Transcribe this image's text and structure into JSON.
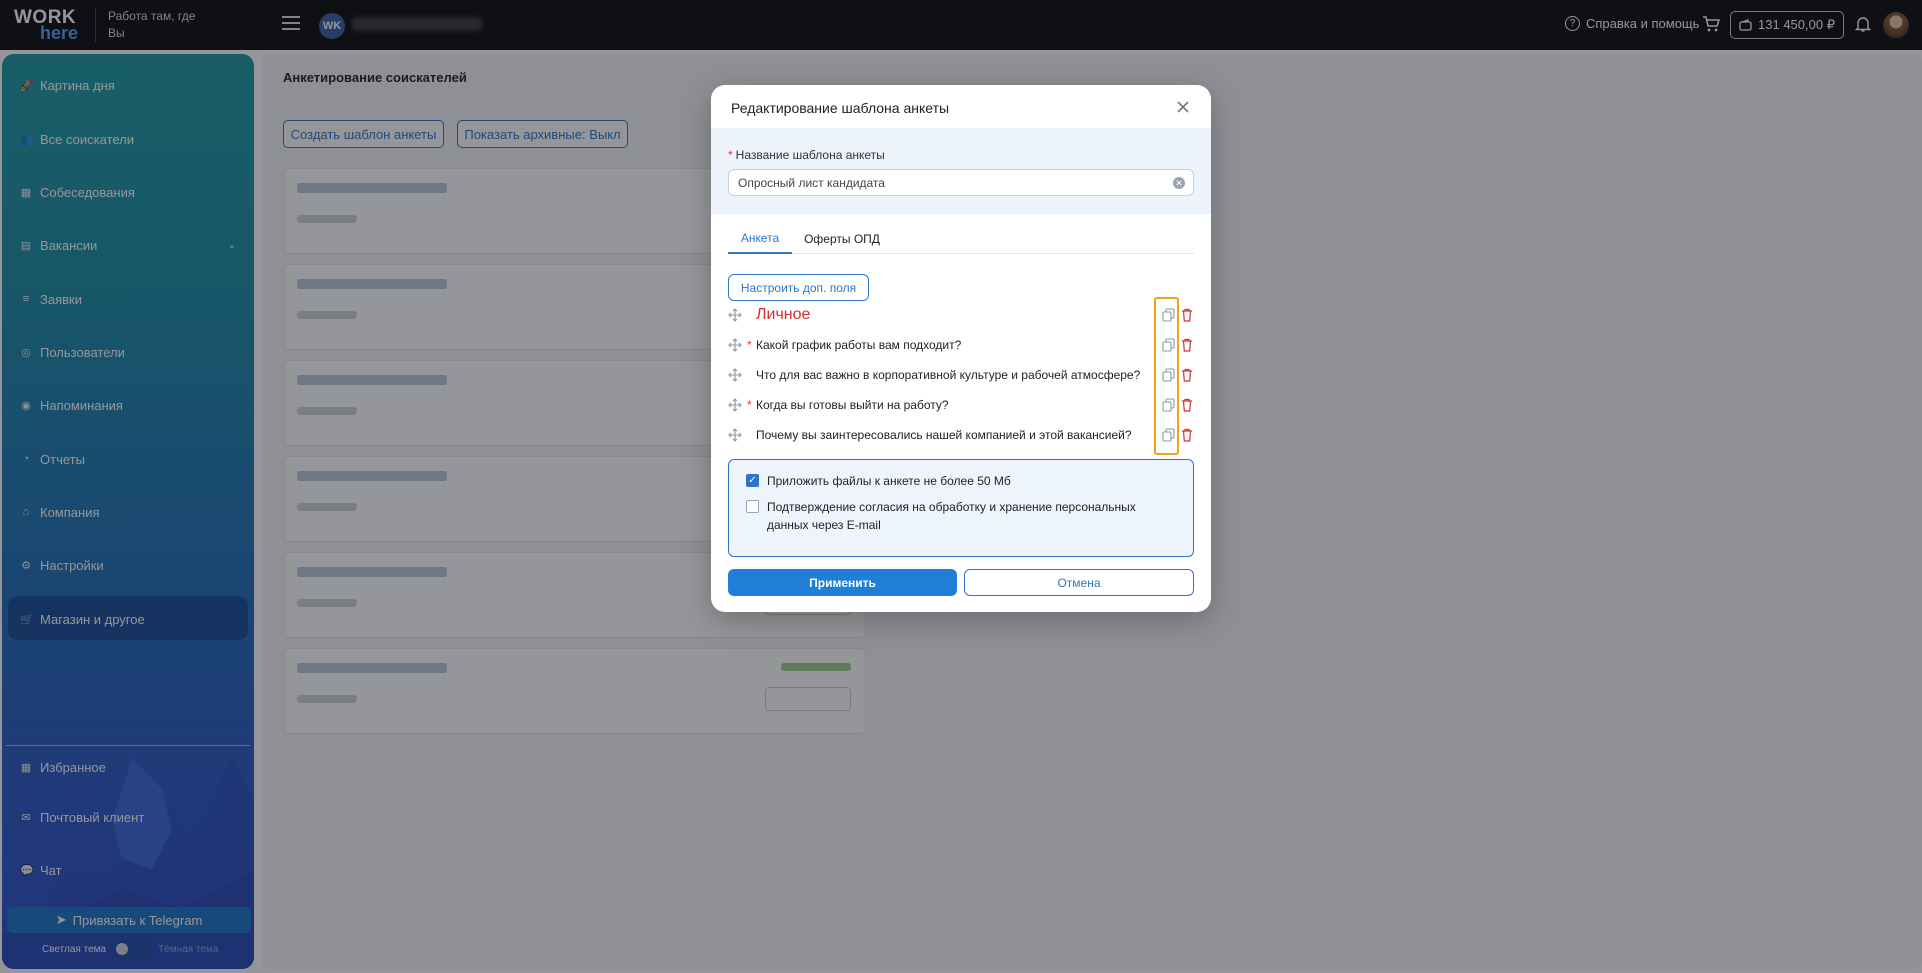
{
  "topbar": {
    "logo_top": "WORK",
    "logo_bottom": "here",
    "tagline": "Работа там, где Вы",
    "org_initials": "WK",
    "help_label": "Справка и помощь",
    "balance": "131 450,00 ₽"
  },
  "sidebar": {
    "items": [
      {
        "label": "Картина дня",
        "icon": "rocket-icon"
      },
      {
        "label": "Все соискатели",
        "icon": "users-icon"
      },
      {
        "label": "Собеседования",
        "icon": "calendar-icon"
      },
      {
        "label": "Вакансии",
        "icon": "briefcase-icon"
      },
      {
        "label": "Заявки",
        "icon": "list-icon"
      },
      {
        "label": "Пользователи",
        "icon": "user-circle-icon"
      },
      {
        "label": "Напоминания",
        "icon": "bell-icon"
      },
      {
        "label": "Отчеты",
        "icon": "chart-icon"
      },
      {
        "label": "Компания",
        "icon": "home-icon"
      },
      {
        "label": "Настройки",
        "icon": "gear-icon"
      },
      {
        "label": "Магазин и другое",
        "icon": "cart-icon"
      },
      {
        "label": "Избранное",
        "icon": "grid-icon"
      },
      {
        "label": "Почтовый клиент",
        "icon": "mail-icon"
      },
      {
        "label": "Чат",
        "icon": "chat-icon"
      }
    ],
    "telegram_button": "Привязать к Telegram",
    "theme_light": "Светлая тема",
    "theme_dark": "Тёмная тема"
  },
  "main": {
    "title": "Анкетирование соискателей",
    "create_button": "Создать шаблон анкеты",
    "archive_button": "Показать архивные: Выкл"
  },
  "modal": {
    "title": "Редактирование шаблона анкеты",
    "name_label": "Название шаблона анкеты",
    "name_value": "Опросный лист кандидата",
    "tabs": [
      "Анкета",
      "Оферты ОПД"
    ],
    "configure_button": "Настроить доп. поля",
    "questions": [
      {
        "text": "Личное",
        "required": false,
        "section": true
      },
      {
        "text": "Какой график работы вам подходит?",
        "required": true,
        "section": false
      },
      {
        "text": "Что для вас важно в корпоративной культуре и рабочей атмосфере?",
        "required": false,
        "section": false
      },
      {
        "text": "Когда вы готовы выйти на работу?",
        "required": true,
        "section": false
      },
      {
        "text": "Почему вы заинтересовались нашей компанией и этой вакансией?",
        "required": false,
        "section": false
      }
    ],
    "options": [
      {
        "label": "Приложить файлы к анкете не более 50 Мб",
        "checked": true
      },
      {
        "label": "Подтверждение согласия на обработку и хранение персональных данных через E-mail",
        "checked": false
      }
    ],
    "apply_button": "Применить",
    "cancel_button": "Отмена"
  },
  "colors": {
    "accent": "#2f74c9",
    "danger": "#d23030",
    "highlight": "#f2a21a"
  }
}
